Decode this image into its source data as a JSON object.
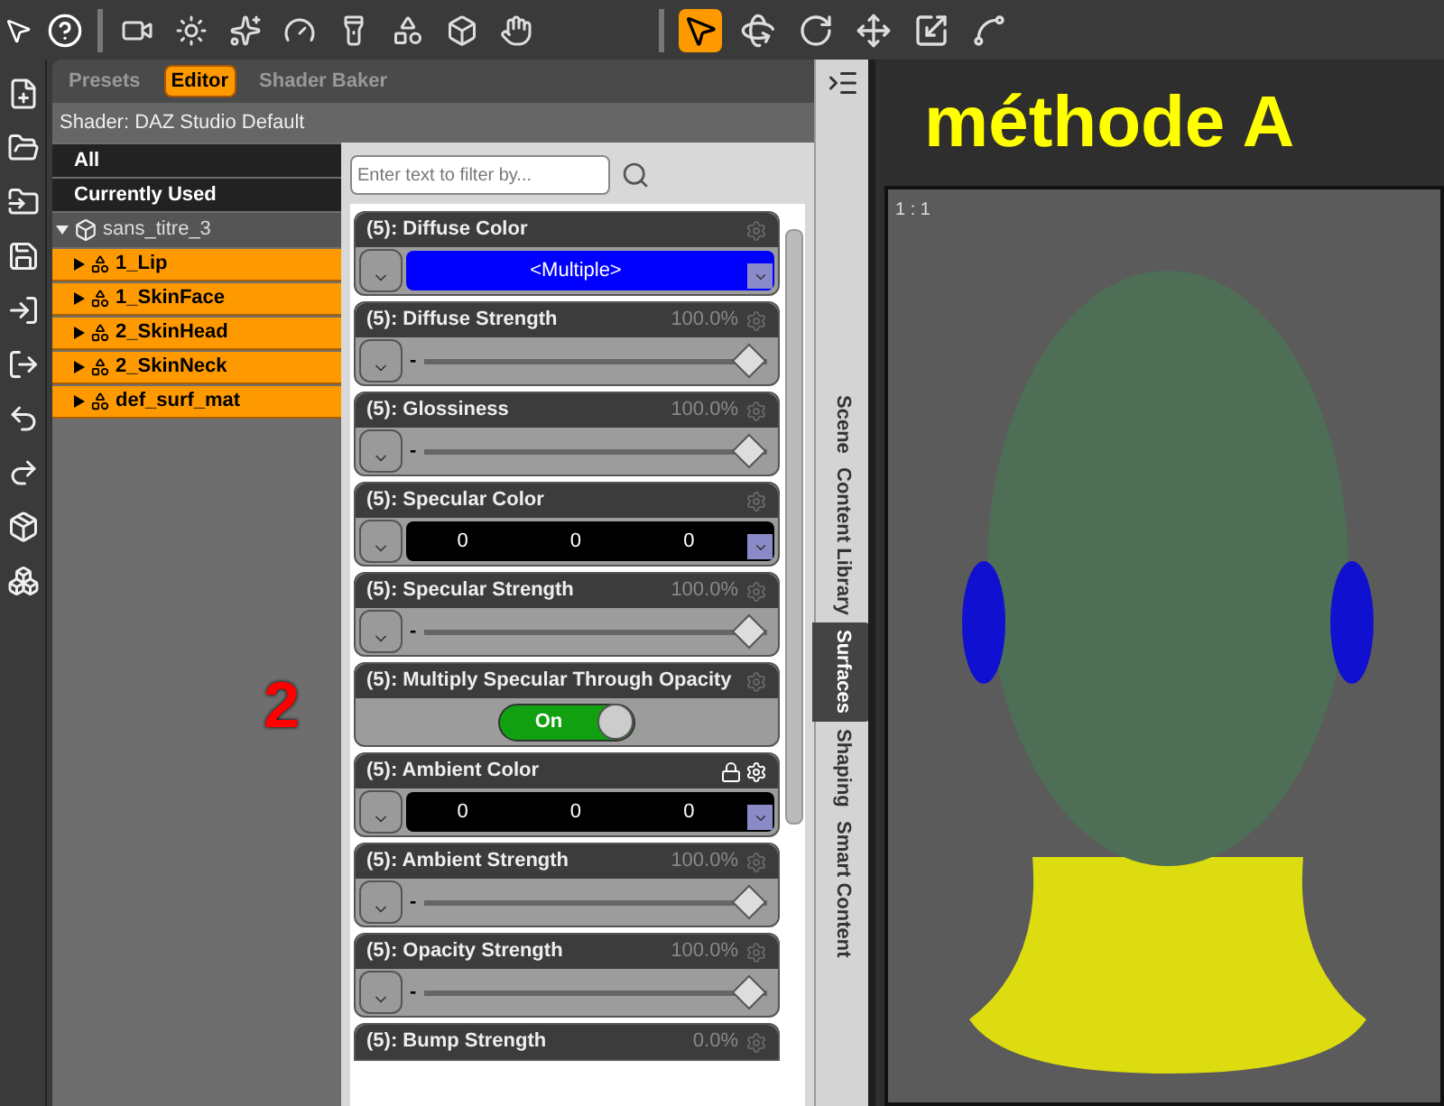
{
  "left_tools": [
    {
      "selected": false
    },
    {
      "selected": false
    },
    {
      "selected": false
    },
    {
      "selected": false
    },
    {
      "selected": false
    },
    {
      "selected": false
    },
    {
      "selected": false
    },
    {
      "selected": false
    }
  ],
  "right_tools": [
    {
      "selected": true
    },
    {
      "selected": false
    },
    {
      "selected": false
    },
    {
      "selected": false
    },
    {
      "selected": false
    },
    {
      "selected": false
    }
  ],
  "panel_tabs": [
    {
      "label": "Presets",
      "selected": false
    },
    {
      "label": "Editor",
      "selected": true
    },
    {
      "label": "Shader Baker",
      "selected": false
    }
  ],
  "shader": "Shader: DAZ Studio Default",
  "filters": [
    {
      "label": "All"
    },
    {
      "label": "Currently Used"
    }
  ],
  "tree": {
    "label": "sans_titre_3",
    "expanded": true,
    "children": [
      {
        "label": "1_Lip",
        "selected": true
      },
      {
        "label": "1_SkinFace",
        "selected": true
      },
      {
        "label": "2_SkinHead",
        "selected": true
      },
      {
        "label": "2_SkinNeck",
        "selected": true
      },
      {
        "label": "def_surf_mat",
        "selected": true
      }
    ]
  },
  "filter_field": {
    "placeholder": "Enter text to filter by..."
  },
  "properties": [
    {
      "kind": "color",
      "label": "(5): Diffuse Color",
      "color": "#0000ff",
      "values": [
        "<Multiple>"
      ],
      "lock_icon": false
    },
    {
      "kind": "slider",
      "label": "(5): Diffuse Strength",
      "reading": "100.0%",
      "scale_label": "-",
      "level": 1,
      "lock_icon": false
    },
    {
      "kind": "slider",
      "label": "(5): Glossiness",
      "reading": "100.0%",
      "scale_label": "-",
      "level": 1,
      "lock_icon": false
    },
    {
      "kind": "color",
      "label": "(5): Specular Color",
      "color": "#000000",
      "values": [
        "0",
        "0",
        "0"
      ],
      "lock_icon": false
    },
    {
      "kind": "slider",
      "label": "(5): Specular Strength",
      "reading": "100.0%",
      "scale_label": "-",
      "level": 1,
      "lock_icon": false
    },
    {
      "kind": "toggle",
      "label": "(5): Multiply Specular Through Opacity",
      "on": true,
      "state_label": "On",
      "lock_icon": false
    },
    {
      "kind": "color",
      "label": "(5): Ambient Color",
      "color": "#000000",
      "values": [
        "0",
        "0",
        "0"
      ],
      "lock_icon": true
    },
    {
      "kind": "slider",
      "label": "(5): Ambient Strength",
      "reading": "100.0%",
      "scale_label": "-",
      "level": 1,
      "lock_icon": false
    },
    {
      "kind": "slider",
      "label": "(5): Opacity Strength",
      "reading": "100.0%",
      "scale_label": "-",
      "level": 1,
      "lock_icon": false
    },
    {
      "kind": "header",
      "label": "(5): Bump Strength",
      "reading": "0.0%",
      "lock_icon": false
    }
  ],
  "side_tabs": [
    {
      "label": "Scene",
      "selected": false
    },
    {
      "label": "Content Library",
      "selected": false
    },
    {
      "label": "Surfaces",
      "selected": true
    },
    {
      "label": "Shaping",
      "selected": false
    },
    {
      "label": "Smart Content",
      "selected": false
    }
  ],
  "annotation": "2",
  "viewport": {
    "title": "méthode A",
    "ratio": "1 : 1"
  }
}
